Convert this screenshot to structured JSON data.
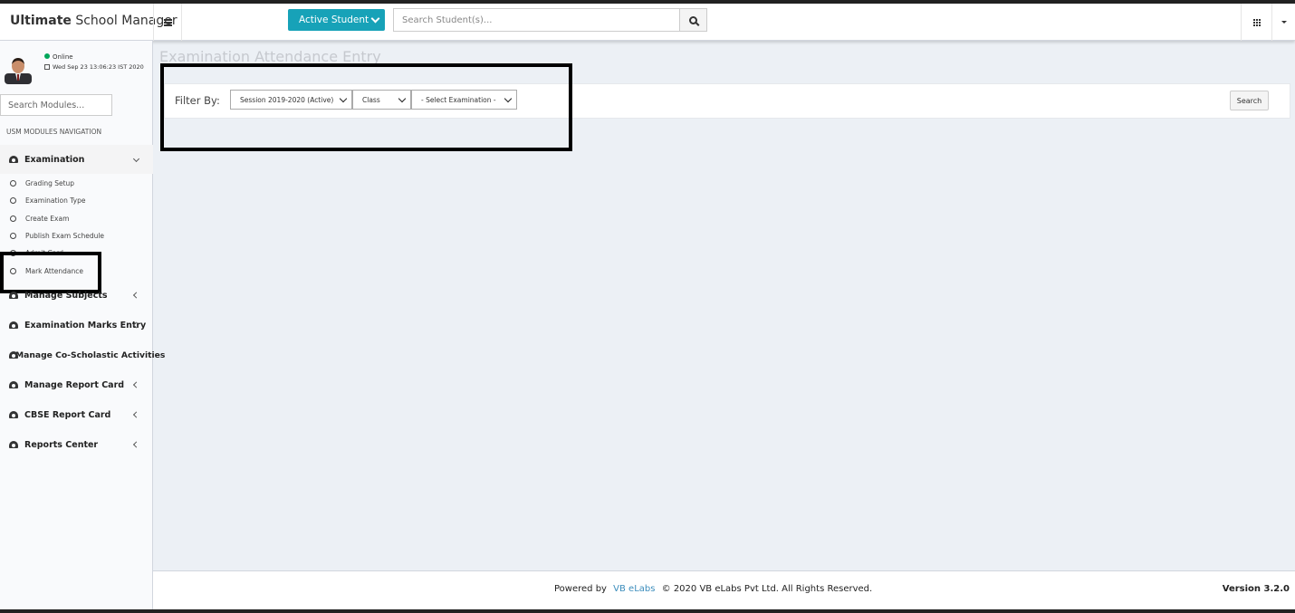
{
  "header": {
    "brand_bold": "Ultimate",
    "brand_rest": " School Manager",
    "active_student_label": "Active Student",
    "search_placeholder": "Search Student(s)..."
  },
  "user": {
    "status": "Online",
    "datetime": "Wed Sep 23 13:06:23 IST 2020"
  },
  "sidebar": {
    "search_placeholder": "Search Modules...",
    "nav_header": "USM MODULES NAVIGATION",
    "exam_label": "Examination",
    "exam_subitems": [
      "Grading Setup",
      "Examination Type",
      "Create Exam",
      "Publish Exam Schedule",
      "Admit Card",
      "Mark Attendance"
    ],
    "items": [
      "Manage Subjects",
      "Examination Marks Entry",
      "Manage Co-Scholastic Activities",
      "Manage Report Card",
      "CBSE Report Card",
      "Reports Center"
    ]
  },
  "main": {
    "title": "Examination Attendance Entry",
    "filter_label": "Filter By:",
    "session_value": "Session 2019-2020 (Active)",
    "class_value": "Class",
    "exam_value": "- Select Examination -",
    "search_label": "Search"
  },
  "footer": {
    "powered_by": "Powered by",
    "company_link": "VB eLabs",
    "copyright": "© 2020 VB eLabs Pvt Ltd. All Rights Reserved.",
    "version": "Version 3.2.0"
  },
  "colors": {
    "accent": "#17a2b8",
    "online": "#00a65a",
    "link": "#3c8dbc"
  }
}
